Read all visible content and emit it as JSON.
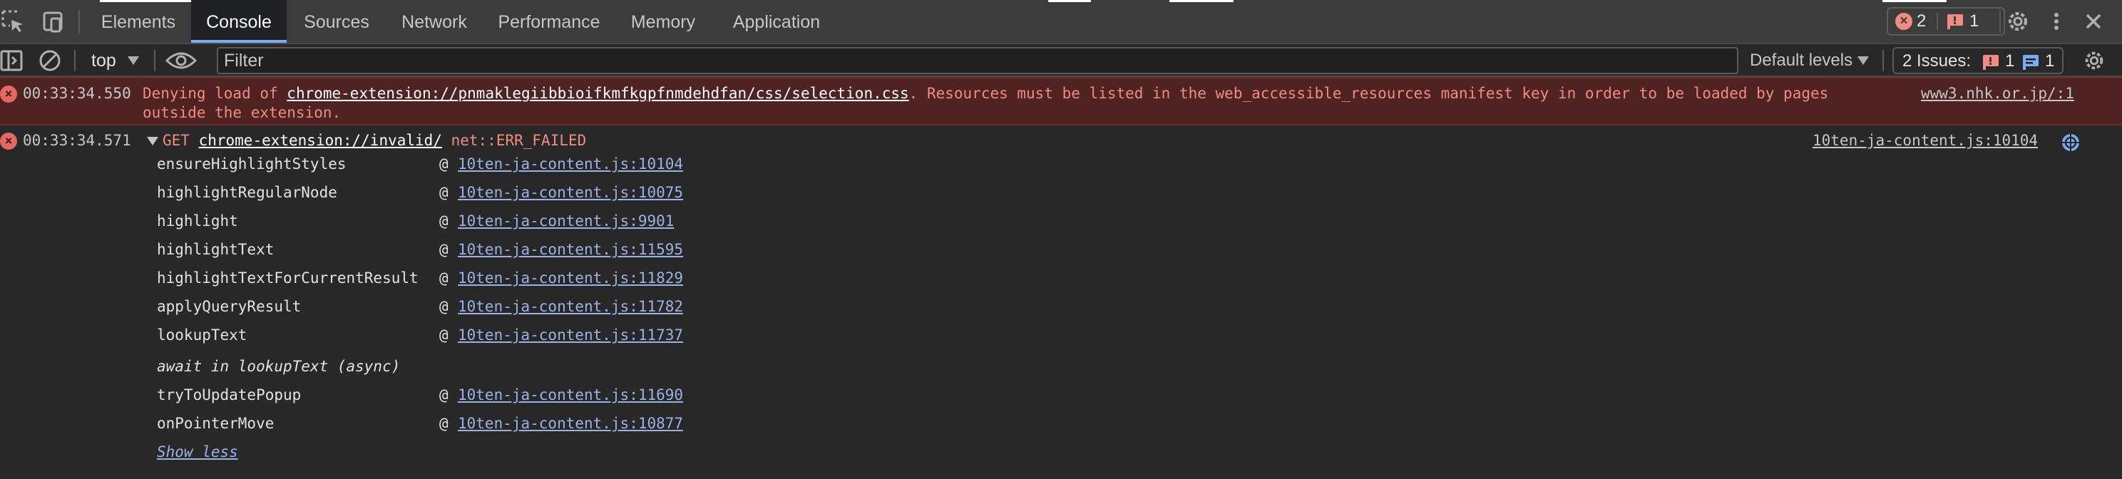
{
  "tabs": [
    {
      "label": "Elements",
      "active": false
    },
    {
      "label": "Console",
      "active": true
    },
    {
      "label": "Sources",
      "active": false
    },
    {
      "label": "Network",
      "active": false
    },
    {
      "label": "Performance",
      "active": false
    },
    {
      "label": "Memory",
      "active": false
    },
    {
      "label": "Application",
      "active": false
    }
  ],
  "header": {
    "error_count": "2",
    "issue_count": "1"
  },
  "toolbar": {
    "context": "top",
    "filter_placeholder": "Filter",
    "levels": "Default levels",
    "issues_label": "2 Issues:",
    "issues_errors": "1",
    "issues_info": "1"
  },
  "messages": {
    "m1": {
      "timestamp": "00:33:34.550",
      "text_before": "Denying load of ",
      "url": "chrome-extension://pnmaklegiibbioifkmfkgpfnmdehdfan/css/selection.css",
      "text_after": ". Resources must be listed in the web_accessible_resources manifest key in order to be loaded by pages ",
      "source": "www3.nhk.or.jp/:1",
      "line2": "outside the extension."
    },
    "m2": {
      "timestamp": "00:33:34.571",
      "method": "GET",
      "url": "chrome-extension://invalid/",
      "error": "net::ERR_FAILED",
      "source": "10ten-ja-content.js:10104",
      "stack": [
        {
          "fn": "ensureHighlightStyles",
          "loc": "10ten-ja-content.js:10104"
        },
        {
          "fn": "highlightRegularNode",
          "loc": "10ten-ja-content.js:10075"
        },
        {
          "fn": "highlight",
          "loc": "10ten-ja-content.js:9901"
        },
        {
          "fn": "highlightText",
          "loc": "10ten-ja-content.js:11595"
        },
        {
          "fn": "highlightTextForCurrentResult",
          "loc": "10ten-ja-content.js:11829"
        },
        {
          "fn": "applyQueryResult",
          "loc": "10ten-ja-content.js:11782"
        },
        {
          "fn": "lookupText",
          "loc": "10ten-ja-content.js:11737"
        },
        {
          "fn": "tryToUpdatePopup",
          "loc": "10ten-ja-content.js:11690"
        },
        {
          "fn": "onPointerMove",
          "loc": "10ten-ja-content.js:10877"
        }
      ],
      "async_label": "await in lookupText (async)",
      "at_sign": "@",
      "show_less": "Show less"
    }
  },
  "colors": {
    "error_bg": "#4e2322",
    "error_text": "#f28b82",
    "link": "#9ab3e4",
    "active_tab_indicator": "#7cacf8"
  }
}
